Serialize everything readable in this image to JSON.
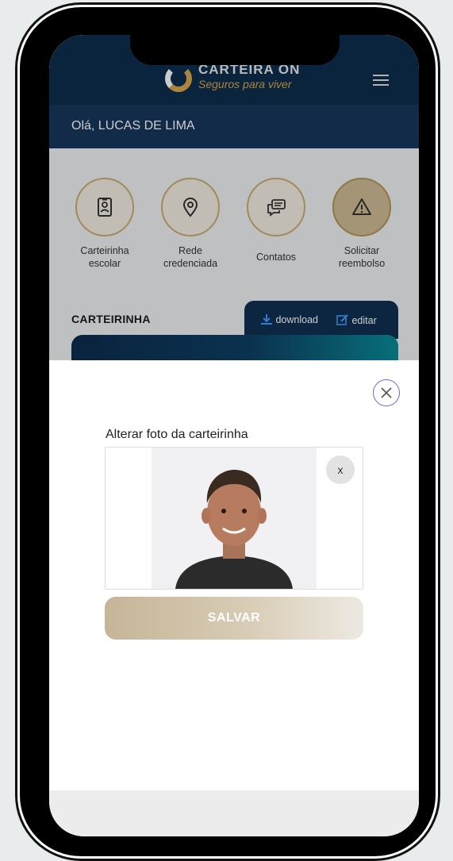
{
  "header": {
    "logo_title": "CARTEIRA ON",
    "logo_tagline": "Seguros para viver"
  },
  "greeting": "Olá, LUCAS DE LIMA",
  "quick_actions": [
    {
      "line1": "Carteirinha",
      "line2": "escolar",
      "icon": "id-card-icon"
    },
    {
      "line1": "Rede",
      "line2": "credenciada",
      "icon": "map-pin-icon"
    },
    {
      "line1": "Contatos",
      "line2": "",
      "icon": "chat-icon"
    },
    {
      "line1": "Solicitar",
      "line2": "reembolso",
      "icon": "warning-icon"
    }
  ],
  "section": {
    "title": "CARTEIRINHA",
    "download_label": "download",
    "edit_label": "editar"
  },
  "modal": {
    "title": "Alterar foto da carteirinha",
    "remove_label": "x",
    "save_label": "SALVAR"
  },
  "colors": {
    "navy": "#0d2d4e",
    "gold": "#c9ad72",
    "save_gradient_start": "#c6b597",
    "close_ring": "#6a6ac8"
  }
}
